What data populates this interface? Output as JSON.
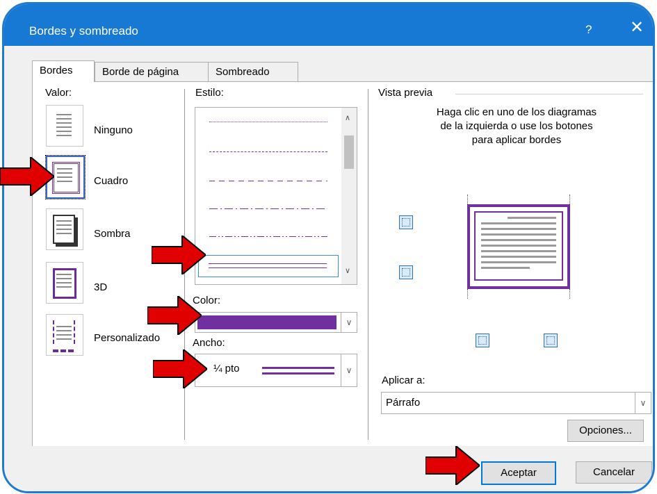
{
  "dialog": {
    "title": "Bordes y sombreado",
    "help_label": "?",
    "close_label": "✕"
  },
  "tabs": [
    {
      "label": "Bordes",
      "active": true
    },
    {
      "label": "Borde de página",
      "active": false
    },
    {
      "label": "Sombreado",
      "active": false
    }
  ],
  "settings": {
    "label": "Valor:",
    "options": [
      {
        "label": "Ninguno",
        "selected": false
      },
      {
        "label": "Cuadro",
        "selected": true
      },
      {
        "label": "Sombra",
        "selected": false
      },
      {
        "label": "3D",
        "selected": false
      },
      {
        "label": "Personalizado",
        "selected": false
      }
    ]
  },
  "style": {
    "label": "Estilo:",
    "items": [
      "dotted",
      "dashed-small",
      "dashed",
      "dash-dot",
      "dash-dot-dot",
      "double"
    ],
    "selected": "double"
  },
  "color": {
    "label": "Color:",
    "value_hex": "#7030a0"
  },
  "width": {
    "label": "Ancho:",
    "value": "¼ pto"
  },
  "preview": {
    "label": "Vista previa",
    "instructions": "Haga clic en uno de los diagramas de la izquierda o use los botones para aplicar bordes"
  },
  "apply_to": {
    "label": "Aplicar a:",
    "value": "Párrafo"
  },
  "buttons": {
    "options": "Opciones...",
    "ok": "Aceptar",
    "cancel": "Cancelar"
  },
  "colors": {
    "accent": "#1779d3",
    "border_purple": "#7030a0",
    "arrow_red": "#e00000"
  }
}
